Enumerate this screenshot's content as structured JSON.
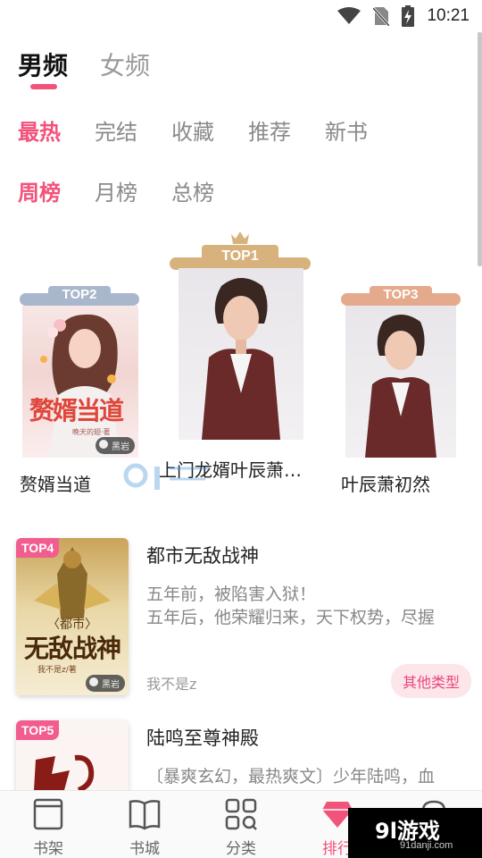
{
  "status_bar": {
    "time": "10:21"
  },
  "gender_tabs": [
    {
      "label": "男频",
      "active": true
    },
    {
      "label": "女频",
      "active": false
    }
  ],
  "category_tabs": [
    {
      "label": "最热",
      "active": true
    },
    {
      "label": "完结",
      "active": false
    },
    {
      "label": "收藏",
      "active": false
    },
    {
      "label": "推荐",
      "active": false
    },
    {
      "label": "新书",
      "active": false
    }
  ],
  "period_tabs": [
    {
      "label": "周榜",
      "active": true
    },
    {
      "label": "月榜",
      "active": false
    },
    {
      "label": "总榜",
      "active": false
    }
  ],
  "podium": {
    "top1": {
      "rank_label": "TOP1",
      "title": "上门龙婿叶辰萧…",
      "ribbon_color": "#d8b27c"
    },
    "top2": {
      "rank_label": "TOP2",
      "title": "赘婿当道",
      "ribbon_color": "#a9b7cc",
      "cover_title": "赘婿当道",
      "cover_author": "晚天的翅·著",
      "publisher": "黑岩"
    },
    "top3": {
      "rank_label": "TOP3",
      "title": "叶辰萧初然",
      "ribbon_color": "#e5a98c"
    }
  },
  "list": [
    {
      "rank_label": "TOP4",
      "title": "都市无敌战神",
      "desc_line1": "五年前，被陷害入狱！",
      "desc_line2": "五年后，他荣耀归来，天下权势，尽握",
      "author": "我不是z",
      "tag": "其他类型",
      "cover_sub": "〈都市〉",
      "cover_title": "无敌战神",
      "cover_author": "我不是z/著",
      "publisher": "黑岩"
    },
    {
      "rank_label": "TOP5",
      "title": "陆鸣至尊神殿",
      "desc_line1": "〔暴爽玄幻，最热爽文〕少年陆鸣，血"
    }
  ],
  "bottom_nav": [
    {
      "label": "书架",
      "icon": "bookshelf-icon",
      "active": false
    },
    {
      "label": "书城",
      "icon": "book-icon",
      "active": false
    },
    {
      "label": "分类",
      "icon": "category-grid-icon",
      "active": false
    },
    {
      "label": "排行",
      "icon": "ranking-gem-icon",
      "active": true
    },
    {
      "label": "",
      "icon": "profile-icon",
      "active": false
    }
  ],
  "watermark": {
    "brand": "9l游戏",
    "site": "91danji.com"
  },
  "colors": {
    "accent": "#f2537b",
    "tag_bg": "#fde6ea"
  }
}
